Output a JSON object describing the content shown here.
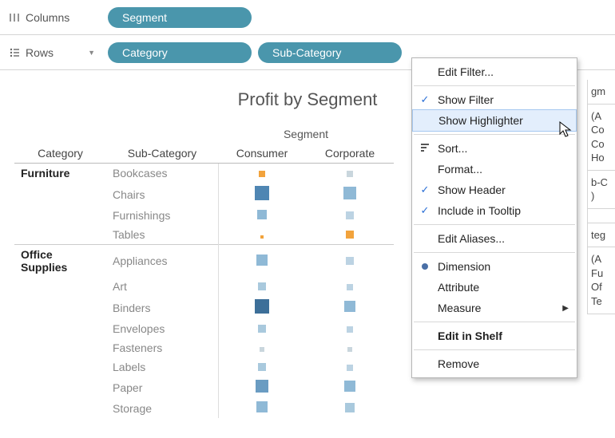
{
  "shelves": {
    "columns_label": "Columns",
    "rows_label": "Rows",
    "columns_pills": [
      "Segment"
    ],
    "rows_pills": [
      "Category",
      "Sub-Category"
    ]
  },
  "viz": {
    "title": "Profit by Segment",
    "segment_header": "Segment",
    "col_headers": [
      "Category",
      "Sub-Category",
      "Consumer",
      "Corporate"
    ],
    "rows": [
      {
        "category": "Furniture",
        "subcat": "Bookcases",
        "marks": [
          {
            "c": "#f2a33c",
            "s": 8
          },
          {
            "c": "#c9d6dd",
            "s": 8
          }
        ]
      },
      {
        "category": "",
        "subcat": "Chairs",
        "marks": [
          {
            "c": "#4f86b3",
            "s": 18
          },
          {
            "c": "#8fb9d6",
            "s": 16
          }
        ]
      },
      {
        "category": "",
        "subcat": "Furnishings",
        "marks": [
          {
            "c": "#8fb9d6",
            "s": 12
          },
          {
            "c": "#bcd3e3",
            "s": 10
          }
        ]
      },
      {
        "category": "",
        "subcat": "Tables",
        "marks": [
          {
            "c": "#f2a33c",
            "s": 4
          },
          {
            "c": "#f2a33c",
            "s": 10
          }
        ]
      },
      {
        "category": "Office Supplies",
        "subcat": "Appliances",
        "marks": [
          {
            "c": "#8fb9d6",
            "s": 14
          },
          {
            "c": "#bcd3e3",
            "s": 10
          }
        ]
      },
      {
        "category": "",
        "subcat": "Art",
        "marks": [
          {
            "c": "#a9c9dd",
            "s": 10
          },
          {
            "c": "#bcd3e3",
            "s": 8
          }
        ]
      },
      {
        "category": "",
        "subcat": "Binders",
        "marks": [
          {
            "c": "#3d6f99",
            "s": 18
          },
          {
            "c": "#8fb9d6",
            "s": 14
          }
        ]
      },
      {
        "category": "",
        "subcat": "Envelopes",
        "marks": [
          {
            "c": "#a9c9dd",
            "s": 10
          },
          {
            "c": "#bcd3e3",
            "s": 8
          }
        ]
      },
      {
        "category": "",
        "subcat": "Fasteners",
        "marks": [
          {
            "c": "#c9d6dd",
            "s": 6
          },
          {
            "c": "#c9d6dd",
            "s": 6
          }
        ]
      },
      {
        "category": "",
        "subcat": "Labels",
        "marks": [
          {
            "c": "#a9c9dd",
            "s": 10
          },
          {
            "c": "#bcd3e3",
            "s": 8
          }
        ]
      },
      {
        "category": "",
        "subcat": "Paper",
        "marks": [
          {
            "c": "#6a9cc2",
            "s": 16
          },
          {
            "c": "#8fb9d6",
            "s": 14
          }
        ]
      },
      {
        "category": "",
        "subcat": "Storage",
        "marks": [
          {
            "c": "#8fb9d6",
            "s": 14
          },
          {
            "c": "#a9c9dd",
            "s": 12
          }
        ]
      }
    ]
  },
  "menu": {
    "items": [
      {
        "label": "Edit Filter...",
        "checked": false
      },
      {
        "sep": true
      },
      {
        "label": "Show Filter",
        "checked": true
      },
      {
        "label": "Show Highlighter",
        "checked": false,
        "hovered": true
      },
      {
        "sep": true
      },
      {
        "label": "Sort...",
        "icon": "sort-icon"
      },
      {
        "label": "Format..."
      },
      {
        "label": "Show Header",
        "checked": true
      },
      {
        "label": "Include in Tooltip",
        "checked": true
      },
      {
        "sep": true
      },
      {
        "label": "Edit Aliases..."
      },
      {
        "sep": true
      },
      {
        "label": "Dimension",
        "icon": "dimension-icon"
      },
      {
        "label": "Attribute"
      },
      {
        "label": "Measure",
        "submenu": true
      },
      {
        "sep": true
      },
      {
        "label": "Edit in Shelf",
        "bold": true
      },
      {
        "sep": true
      },
      {
        "label": "Remove"
      }
    ]
  },
  "right_fragments": {
    "cells": [
      [
        "gm"
      ],
      [
        "(A",
        "Co",
        "Co",
        "Ho"
      ],
      [
        "b-C",
        ")"
      ],
      [],
      [
        "teg"
      ],
      [
        "(A",
        "Fu",
        "Of",
        "Te"
      ]
    ]
  }
}
